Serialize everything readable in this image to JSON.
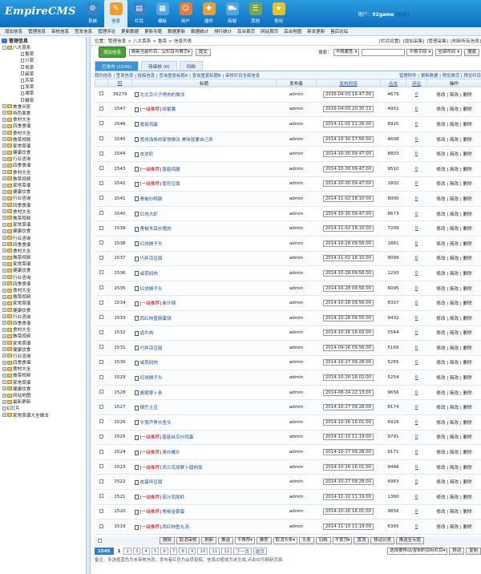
{
  "brand": {
    "logo": "EmpireCMS"
  },
  "topnav": [
    {
      "label": "系统",
      "icon": "gear-icon",
      "color": "#3b82c4"
    },
    {
      "label": "信息",
      "icon": "document-icon",
      "color": "#f29b2f"
    },
    {
      "label": "栏目",
      "icon": "folder-icon",
      "color": "#3b82c4"
    },
    {
      "label": "模板",
      "icon": "template-icon",
      "color": "#5aa5de"
    },
    {
      "label": "用户",
      "icon": "user-icon",
      "color": "#e57b3c"
    },
    {
      "label": "插件",
      "icon": "plugin-icon",
      "color": "#e5a23c"
    },
    {
      "label": "商城",
      "icon": "cart-icon",
      "color": "#5aa5de"
    },
    {
      "label": "其他",
      "icon": "misc-icon",
      "color": "#7aa34a"
    },
    {
      "label": "常用",
      "icon": "star-icon",
      "color": "#e8c22a"
    }
  ],
  "user": {
    "prefix": "用户：",
    "name": "92game",
    "logout": "[退出]"
  },
  "subnav": [
    "增加信息",
    "管理信息",
    "审核信息",
    "签发信息",
    "管理评论",
    "更新数据",
    "更新专题",
    "数据更新",
    "数据统计",
    "排行统计",
    "后台首页",
    "网站首页",
    "后台地图",
    "新本更新",
    "售后论坛"
  ],
  "tree": {
    "root": "管理信息",
    "open_node": "八大菜系",
    "children": [
      "鲁菜",
      "川菜",
      "粤菜",
      "闽菜",
      "苏菜",
      "浙菜",
      "湘菜",
      "徽菜"
    ],
    "nodes": [
      "美食问答",
      "特色面食",
      "食材大全",
      "四季食谱",
      "食材大全",
      "做菜视频",
      "家常菜谱",
      "健康饮食",
      "行业咨询",
      "四季食谱",
      "食材大全",
      "做菜视频",
      "家常菜谱",
      "健康饮食",
      "行业咨询",
      "四季食谱",
      "食材大全",
      "做菜视频",
      "家常菜谱",
      "健康饮食",
      "行业咨询",
      "四季食谱",
      "食材大全",
      "做菜视频",
      "家常菜谱",
      "健康饮食",
      "行业咨询",
      "四季食谱",
      "食材大全",
      "做菜视频",
      "家常菜谱",
      "健康饮食",
      "行业咨询",
      "四季食谱",
      "食材大全",
      "做菜视频",
      "家常菜谱",
      "健康饮食",
      "行业咨询",
      "四季食谱",
      "食材大全",
      "做菜视频",
      "家常菜谱",
      "健康饮食",
      "网站地图",
      "最新更新"
    ],
    "extra_leaf": "幻灯片",
    "last_node": "家常菜谱大全做法"
  },
  "location": {
    "prefix": "位置：",
    "crumbs": [
      "管理信息",
      ">",
      "八大菜系",
      ">",
      "鲁菜",
      ">",
      "信息列表"
    ],
    "right_links": [
      "[栏目设置]",
      "[增加采集]",
      "[管理采集]",
      "[刷新所有信息]"
    ]
  },
  "toolbar": {
    "add_label": "增加信息",
    "refresh_select": "刷新当前栏目、父栏目与首页",
    "submit": "提交",
    "search_label": "搜索：",
    "attr_select": "不限属性",
    "field_select": "不限字段",
    "time_select": "全部时间",
    "search_btn": "搜索"
  },
  "tabs": {
    "published": "已发布 (1545)",
    "pending": "待审核 (0)",
    "archive": "归档"
  },
  "filter": {
    "left": "我的信息 | 签发信息 | 投稿信息 | 查询重复标题A | 查询重复标题B | 审核栏目全部信息",
    "right": "管理附件 | 更新数据 | 预览首页 | 预览栏目"
  },
  "columns": {
    "id": "ID",
    "title": "标题",
    "author": "发布者",
    "time": "发布时间",
    "clicks": "点击",
    "comments": "评论",
    "ops": "操作"
  },
  "op_text": "修改 | 简改 | 删除",
  "rows": [
    {
      "id": "39279",
      "rec": "",
      "title": "北北京爪子烤肉的做法",
      "author": "admin",
      "time": "2016-04-03 16:47:00",
      "clicks": "4679",
      "comments": "0"
    },
    {
      "id": "1547",
      "rec": "[一级推荐]",
      "title": "焰紫薯",
      "author": "admin",
      "time": "2016-04-03 20:30:11",
      "clicks": "4951",
      "comments": "0"
    },
    {
      "id": "1546",
      "rec": "",
      "title": "香菇鸡蛋",
      "author": "admin",
      "time": "2014-11-01 11:26:00",
      "clicks": "8920",
      "comments": "0"
    },
    {
      "id": "1545",
      "rec": "",
      "title": "葱烧海参的家常做法 美味就要自己来",
      "author": "admin",
      "time": "2014-10-30 17:56:00",
      "clicks": "4608",
      "comments": "0"
    },
    {
      "id": "1544",
      "rec": "",
      "title": "皮皮虾",
      "author": "admin",
      "time": "2014-10-30 09:47:00",
      "clicks": "8803",
      "comments": "0"
    },
    {
      "id": "1543",
      "rec": "[一级推荐]",
      "title": "香菇鸡腿",
      "author": "admin",
      "time": "2014-10-30 09:47:00",
      "clicks": "9510",
      "comments": "0"
    },
    {
      "id": "1542",
      "rec": "[一级推荐]",
      "title": "香煎豆腐",
      "author": "admin",
      "time": "2014-10-30 09:47:00",
      "clicks": "1802",
      "comments": "0"
    },
    {
      "id": "1541",
      "rec": "",
      "title": "青椒炒鸭肠",
      "author": "admin",
      "time": "2014-11-02 18:10:00",
      "clicks": "8000",
      "comments": "0"
    },
    {
      "id": "1540",
      "rec": "",
      "title": "红烧大虾",
      "author": "admin",
      "time": "2014-10-30 09:47:00",
      "clicks": "8673",
      "comments": "0"
    },
    {
      "id": "1539",
      "rec": "",
      "title": "青椒木耳炒猪肉",
      "author": "admin",
      "time": "2014-11-02 18:10:00",
      "clicks": "7209",
      "comments": "0"
    },
    {
      "id": "1538",
      "rec": "",
      "title": "红烧狮子头",
      "author": "admin",
      "time": "2014-10-28 09:56:00",
      "clicks": "1861",
      "comments": "0"
    },
    {
      "id": "1537",
      "rec": "",
      "title": "巧拌凉豆腐",
      "author": "admin",
      "time": "2014-11-02 18:10:00",
      "clicks": "9099",
      "comments": "0"
    },
    {
      "id": "1536",
      "rec": "",
      "title": "咸菜焖肉",
      "author": "admin",
      "time": "2014-10-28 09:56:00",
      "clicks": "1293",
      "comments": "0"
    },
    {
      "id": "1535",
      "rec": "",
      "title": "红烧狮子头",
      "author": "admin",
      "time": "2014-10-28 09:56:00",
      "clicks": "6095",
      "comments": "0"
    },
    {
      "id": "1534",
      "rec": "[一级推荐]",
      "title": "素什锦",
      "author": "admin",
      "time": "2014-10-28 09:56:00",
      "clicks": "8307",
      "comments": "0"
    },
    {
      "id": "1533",
      "rec": "",
      "title": "西红柿香肠蛋饼",
      "author": "admin",
      "time": "2014-10-28 09:55:00",
      "clicks": "9432",
      "comments": "0"
    },
    {
      "id": "1532",
      "rec": "",
      "title": "卤牛肉",
      "author": "admin",
      "time": "2014-10-26 16:02:00",
      "clicks": "5564",
      "comments": "0"
    },
    {
      "id": "1531",
      "rec": "",
      "title": "巧拌凉豆腐",
      "author": "admin",
      "time": "2014-09-16 09:56:00",
      "clicks": "5169",
      "comments": "0"
    },
    {
      "id": "1530",
      "rec": "",
      "title": "咸菜焖肉",
      "author": "admin",
      "time": "2014-10-27 09:28:00",
      "clicks": "5265",
      "comments": "0"
    },
    {
      "id": "1529",
      "rec": "",
      "title": "红烧狮子头",
      "author": "admin",
      "time": "2014-10-26 16:02:00",
      "clicks": "5254",
      "comments": "0"
    },
    {
      "id": "1528",
      "rec": "",
      "title": "酱猪萝卜条",
      "author": "admin",
      "time": "2014-08-24 22:13:00",
      "clicks": "9656",
      "comments": "0"
    },
    {
      "id": "1527",
      "rec": "",
      "title": "锅巴土豆",
      "author": "admin",
      "time": "2014-10-27 09:28:00",
      "clicks": "8174",
      "comments": "0"
    },
    {
      "id": "1526",
      "rec": "",
      "title": "牛蒡芦笋炒鱼头",
      "author": "admin",
      "time": "2014-10-26 16:01:00",
      "clicks": "6929",
      "comments": "0"
    },
    {
      "id": "1525",
      "rec": "[一级推荐]",
      "title": "香菇丝瓜炒鸡蛋",
      "author": "admin",
      "time": "2014-11-10 11:19:00",
      "clicks": "9791",
      "comments": "0"
    },
    {
      "id": "1524",
      "rec": "[一级推荐]",
      "title": "清炒螺片",
      "author": "admin",
      "time": "2014-10-27 09:28:00",
      "clicks": "9171",
      "comments": "0"
    },
    {
      "id": "1523",
      "rec": "[一级推荐]",
      "title": "西兰花胡萝卜腊肉饭",
      "author": "admin",
      "time": "2014-10-26 16:01:00",
      "clicks": "9448",
      "comments": "0"
    },
    {
      "id": "1522",
      "rec": "",
      "title": "皮蛋拌豆腐",
      "author": "admin",
      "time": "2014-10-27 09:28:00",
      "clicks": "6983",
      "comments": "0"
    },
    {
      "id": "1521",
      "rec": "[一级推荐]",
      "title": "茄汁凤尾虾",
      "author": "admin",
      "time": "2014-11-10 11:19:00",
      "clicks": "1360",
      "comments": "0"
    },
    {
      "id": "1520",
      "rec": "[一级推荐]",
      "title": "青椒金银蛋",
      "author": "admin",
      "time": "2014-10-26 16:01:00",
      "clicks": "9856",
      "comments": "0"
    },
    {
      "id": "1519",
      "rec": "[一级推荐]",
      "title": "西红柿鱼丸汤",
      "author": "admin",
      "time": "2014-11-10 11:19:00",
      "clicks": "6365",
      "comments": "0"
    }
  ],
  "bulk": {
    "delete": "删除",
    "unaudit": "取消审核",
    "refresh": "刷新",
    "push": "推送",
    "rec_select": "不推荐",
    "recommend": "推荐",
    "top_select": "取消头条",
    "headline": "头条",
    "archive": "归档",
    "order_select": "不置顶",
    "top": "置顶",
    "move_select": "移动分类",
    "push_special": "推送至专题"
  },
  "pager": {
    "current": "1545",
    "pages": [
      "1",
      "2",
      "3",
      "4",
      "5",
      "6",
      "7",
      "8",
      "9",
      "10",
      "11",
      "12"
    ],
    "next": "下一页",
    "last": "尾页",
    "move_select": "选择要移动/复制的目标栏目",
    "move_btn": "移动",
    "copy_btn": "复制"
  },
  "note": "备注：多选框蓝色为未审核信息；发布者红色为会员投稿；信息ID粗体为未生成,点击ID可刷新页面."
}
